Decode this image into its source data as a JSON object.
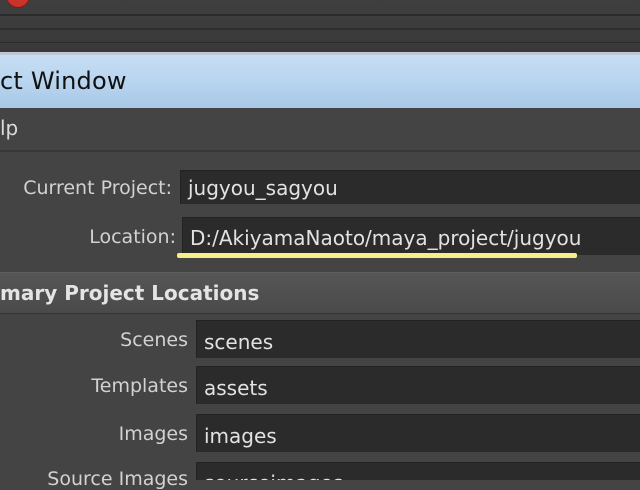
{
  "window": {
    "title": "ct Window"
  },
  "menu": {
    "items": [
      "lp"
    ]
  },
  "project": {
    "current_label": "Current Project:",
    "current_value": "jugyou_sagyou",
    "location_label": "Location:",
    "location_value": "D:/AkiyamaNaoto/maya_project/jugyou"
  },
  "section": {
    "title": "mary Project Locations"
  },
  "locations": [
    {
      "label": "Scenes",
      "value": "scenes"
    },
    {
      "label": "Templates",
      "value": "assets"
    },
    {
      "label": "Images",
      "value": "images"
    },
    {
      "label": "Source Images",
      "value": "sourceimages"
    }
  ],
  "colors": {
    "title_bar": "#b9d4ee",
    "panel": "#444444",
    "field": "#2b2b2b",
    "highlight": "#f6ee86",
    "close_button": "#c9332a"
  }
}
